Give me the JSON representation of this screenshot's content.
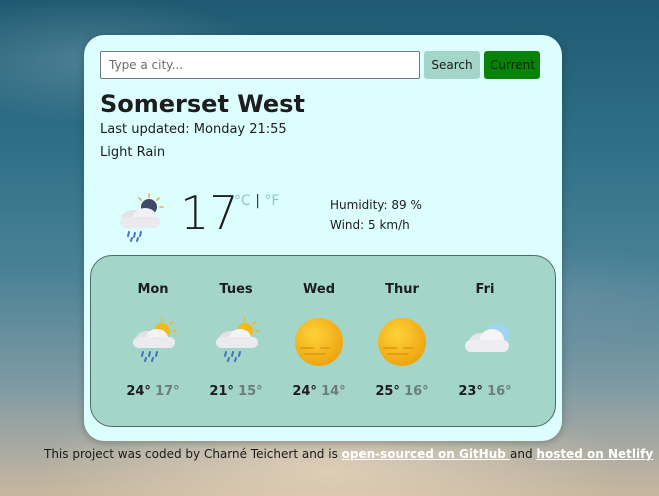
{
  "search": {
    "placeholder": "Type a city...",
    "search_label": "Search",
    "current_label": "Current"
  },
  "current": {
    "city": "Somerset West",
    "updated": "Last updated: Monday 21:55",
    "description": "Light Rain",
    "icon": "rain-cloud-moon-icon",
    "temperature": "17",
    "unit_c": "°C",
    "unit_sep": "|",
    "unit_f": "°F",
    "humidity": "Humidity: 89 %",
    "wind": "Wind: 5 km/h"
  },
  "forecast": [
    {
      "day": "Mon",
      "icon": "sun-cloud-rain-icon",
      "hi": "24°",
      "lo": "17°"
    },
    {
      "day": "Tues",
      "icon": "sun-cloud-rain-icon",
      "hi": "21°",
      "lo": "15°"
    },
    {
      "day": "Wed",
      "icon": "sun-haze-icon",
      "hi": "24°",
      "lo": "14°"
    },
    {
      "day": "Thur",
      "icon": "sun-haze-icon",
      "hi": "25°",
      "lo": "16°"
    },
    {
      "day": "Fri",
      "icon": "cloud-icon",
      "hi": "23°",
      "lo": "16°"
    }
  ],
  "footer": {
    "text": "This project was coded by Charné Teichert and is ",
    "github_link": "open-sourced on GitHub ",
    "and": "and ",
    "netlify_link": "hosted on Netlify"
  },
  "colors": {
    "card": "#dcfeff",
    "forecast_panel": "#a3d5c8",
    "search_button": "#a3d5c8",
    "current_button": "#088208"
  }
}
